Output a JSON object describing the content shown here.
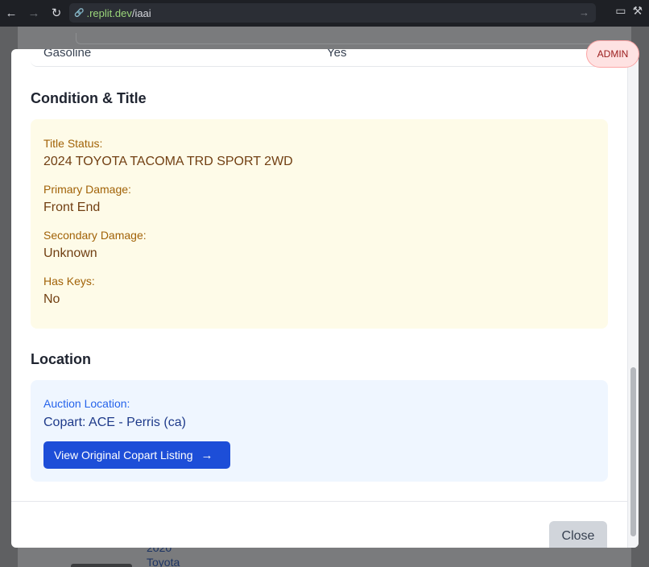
{
  "browser": {
    "url_domain": ".replit.dev",
    "url_path": "/iaai",
    "back_icon": "←",
    "forward_icon": "→",
    "reload_icon": "↻",
    "link_icon": "🔗",
    "url_forward_icon": "→",
    "screen_icon": "▭",
    "tool_icon": "⚒"
  },
  "background": {
    "link_line1": "2020",
    "link_line2": "Toyota"
  },
  "badge": {
    "label": "ADMIN"
  },
  "modal": {
    "prev_row": {
      "label": "Gasoline",
      "value": "Yes"
    },
    "condition": {
      "heading": "Condition & Title",
      "fields": [
        {
          "label": "Title Status:",
          "value": "2024 TOYOTA TACOMA TRD SPORT 2WD"
        },
        {
          "label": "Primary Damage:",
          "value": "Front End"
        },
        {
          "label": "Secondary Damage:",
          "value": "Unknown"
        },
        {
          "label": "Has Keys:",
          "value": "No"
        }
      ]
    },
    "location": {
      "heading": "Location",
      "label": "Auction Location:",
      "value": "Copart: ACE - Perris (ca)",
      "button_label": "View Original Copart Listing",
      "button_icon": "→"
    },
    "close_label": "Close"
  },
  "colors": {
    "condition_bg": "#fefbe8",
    "condition_label": "#a16207",
    "location_bg": "#eff6ff",
    "accent": "#1d4ed8",
    "admin_bg": "#fee2e2"
  }
}
